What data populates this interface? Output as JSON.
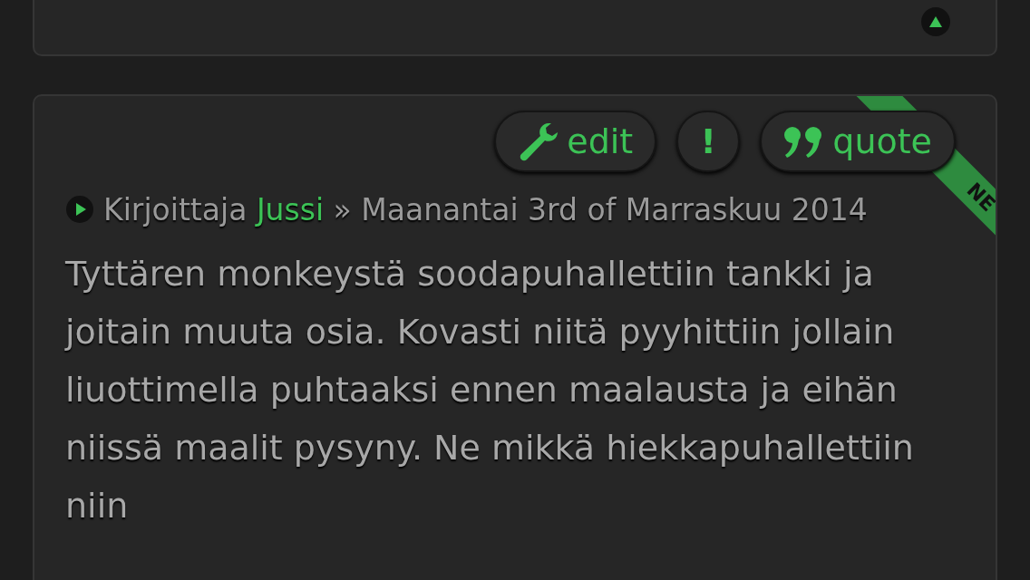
{
  "previous_post": {
    "has_top_button": true
  },
  "post": {
    "ribbon": "NE",
    "actions": [
      {
        "kind": "edit",
        "label": "edit"
      },
      {
        "kind": "report",
        "label": "!"
      },
      {
        "kind": "quote",
        "label": "quote"
      }
    ],
    "meta": {
      "prefix": "Kirjoittaja",
      "author": "Jussi",
      "separator": "»",
      "date": "Maanantai 3rd of Marraskuu 2014"
    },
    "body": "Tyttären monkeystä soodapuhallettiin tankki ja joitain muuta osia. Kovasti niitä pyyhittiin jollain liuottimella puhtaaksi ennen maalausta ja eihän niissä maalit pysyny. Ne mikkä hiekkapuhallettiin niin"
  }
}
